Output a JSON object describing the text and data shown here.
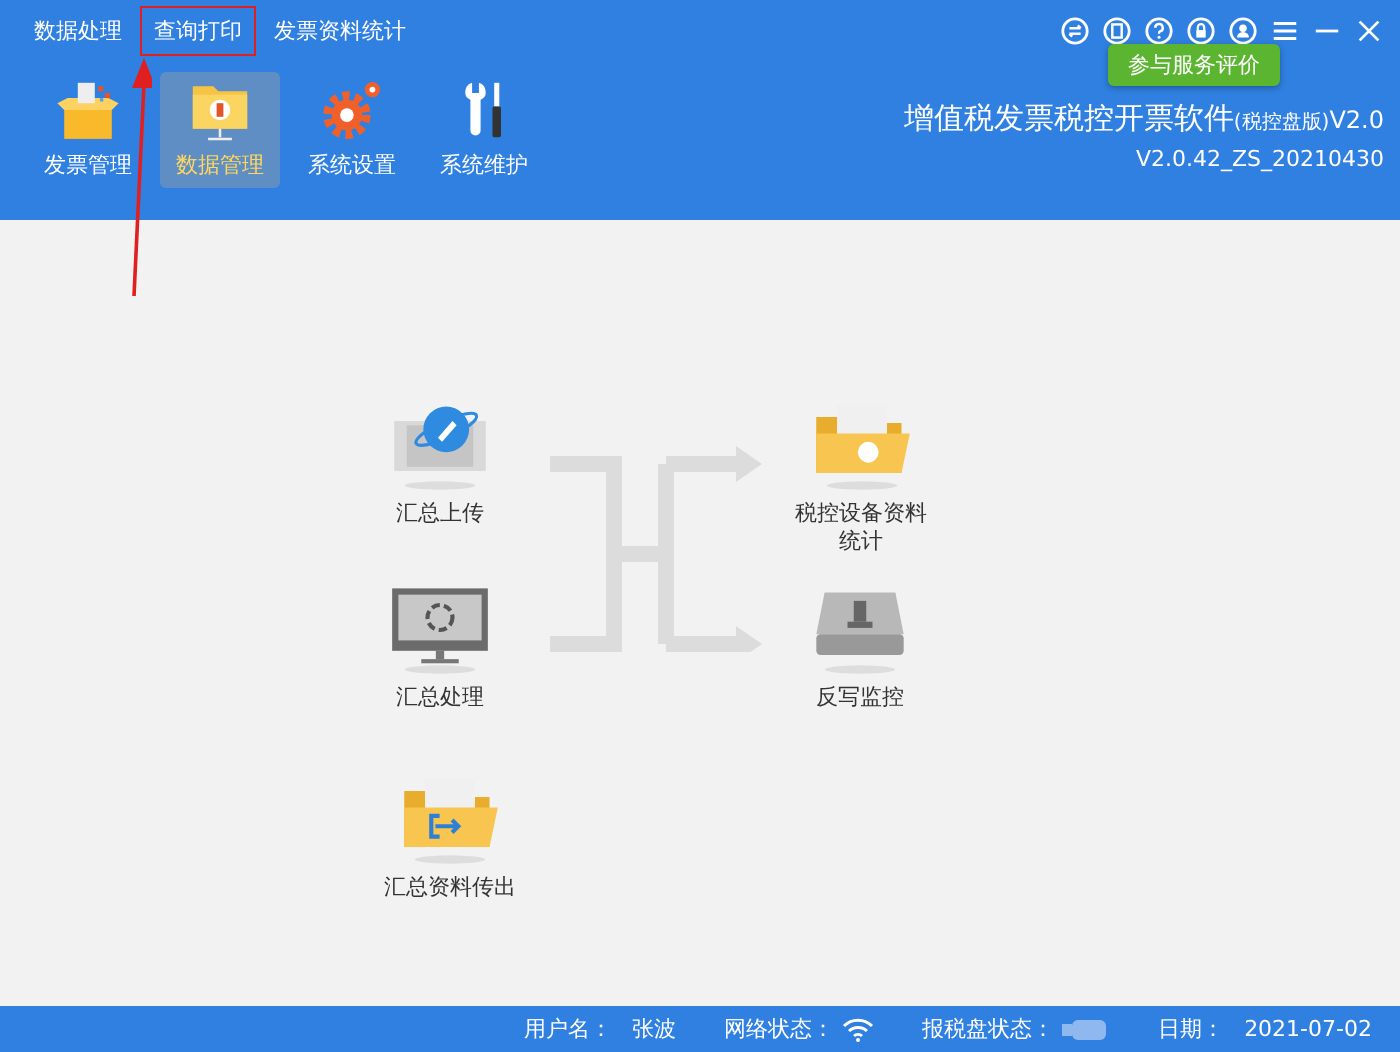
{
  "menu": [
    {
      "label": "数据处理",
      "highlighted": false
    },
    {
      "label": "查询打印",
      "highlighted": true
    },
    {
      "label": "发票资料统计",
      "highlighted": false
    }
  ],
  "tooltip": "参与服务评价",
  "toolbar": [
    {
      "label": "发票管理",
      "kind": "box",
      "selected": false
    },
    {
      "label": "数据管理",
      "kind": "folder",
      "selected": true
    },
    {
      "label": "系统设置",
      "kind": "gear",
      "selected": false
    },
    {
      "label": "系统维护",
      "kind": "tools",
      "selected": false
    }
  ],
  "title": {
    "main": "增值税发票税控开票软件",
    "edition": "(税控盘版)",
    "version": "V2.0"
  },
  "build": "V2.0.42_ZS_20210430",
  "functions": [
    {
      "label": "汇总上传",
      "kind": "upload"
    },
    {
      "label": "汇总处理",
      "kind": "process"
    },
    {
      "label": "汇总资料传出",
      "kind": "export"
    },
    {
      "label": "税控设备资料统计",
      "kind": "stats"
    },
    {
      "label": "反写监控",
      "kind": "monitor"
    }
  ],
  "status": {
    "user_label": "用户名：",
    "user": "张波",
    "network_label": "网络状态：",
    "disk_label": "报税盘状态：",
    "date_label": "日期：",
    "date": "2021-07-02"
  }
}
